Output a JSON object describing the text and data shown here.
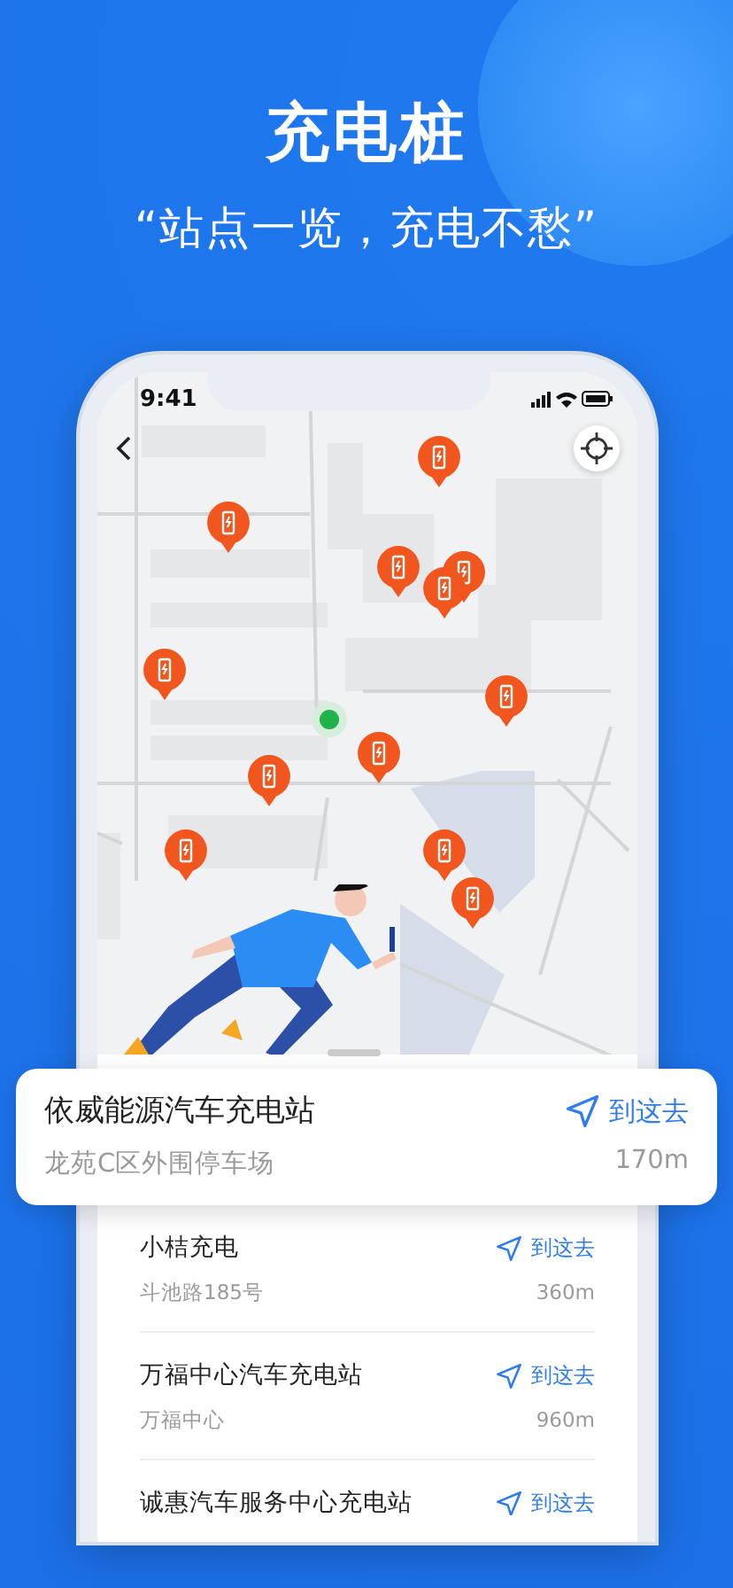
{
  "header": {
    "title": "充电桩",
    "subtitle": "“站点一览，充电不愁”"
  },
  "status_bar": {
    "time": "9:41"
  },
  "featured": {
    "name": "依威能源汽车充电站",
    "address": "龙苑C区外围停车场",
    "distance": "170m",
    "action": "到这去"
  },
  "stations": [
    {
      "name": "小桔充电",
      "address": "斗池路185号",
      "distance": "360m",
      "action": "到这去"
    },
    {
      "name": "万福中心汽车充电站",
      "address": "万福中心",
      "distance": "960m",
      "action": "到这去"
    },
    {
      "name": "诚惠汽车服务中心充电站",
      "action": "到这去"
    }
  ]
}
